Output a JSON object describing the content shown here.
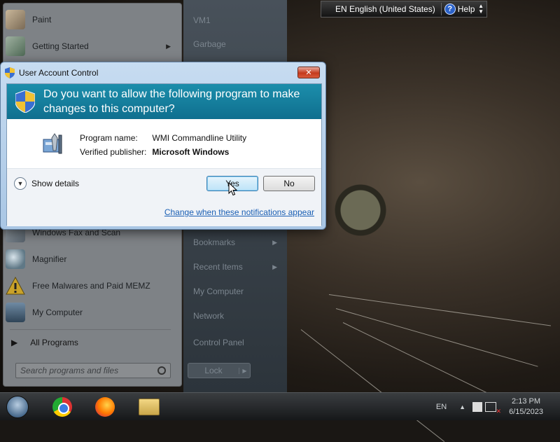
{
  "language_bar": {
    "language": "EN English (United States)",
    "help_label": "Help"
  },
  "start_menu": {
    "left_items": [
      {
        "label": "Paint",
        "has_submenu": false
      },
      {
        "label": "Getting Started",
        "has_submenu": true
      },
      {
        "label": "Windows Fax and Scan",
        "has_submenu": false
      },
      {
        "label": "Magnifier",
        "has_submenu": false
      },
      {
        "label": "Free Malwares and Paid MEMZ",
        "has_submenu": false
      },
      {
        "label": "My Computer",
        "has_submenu": false
      }
    ],
    "all_programs": "All Programs",
    "search_placeholder": "Search programs and files",
    "right_items": [
      {
        "label": "VM1"
      },
      {
        "label": "Garbage"
      },
      {
        "label": "Bookmarks",
        "has_submenu": true
      },
      {
        "label": "Recent Items",
        "has_submenu": true
      },
      {
        "label": "My Computer"
      },
      {
        "label": "Network"
      },
      {
        "label": "Control Panel"
      }
    ],
    "lock_label": "Lock"
  },
  "uac": {
    "title": "User Account Control",
    "close_label": "✕",
    "question": "Do you want to allow the following program to make changes to this computer?",
    "program_name_label": "Program name:",
    "program_name": "WMI Commandline Utility",
    "publisher_label": "Verified publisher:",
    "publisher": "Microsoft Windows",
    "show_details": "Show details",
    "yes_label": "Yes",
    "no_label": "No",
    "change_link": "Change when these notifications appear"
  },
  "taskbar": {
    "tray_language": "EN",
    "time": "2:13 PM",
    "date": "6/15/2023"
  },
  "colors": {
    "uac_header": "#1c8eab",
    "link": "#1a5fb4",
    "close_button": "#c43a1d"
  }
}
